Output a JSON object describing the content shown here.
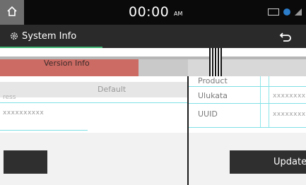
{
  "status_bar": {
    "clock": "00:00",
    "ampm": "AM",
    "icons": [
      "media-icon",
      "bluetooth-icon",
      "signal-icon"
    ]
  },
  "title_bar": {
    "title": "System Info"
  },
  "tab": {
    "label": "Version Info"
  },
  "left_panel": {
    "default_label": "Default",
    "row_cut_text": "ress",
    "value_text": "xxxxxxxxxx"
  },
  "right_panel": {
    "rows": [
      {
        "label": "Product",
        "value": ""
      },
      {
        "label": "Ulukata",
        "value": "xxxxxxxxx"
      },
      {
        "label": "UUID",
        "value": "xxxxxxxxxx"
      }
    ]
  },
  "buttons": {
    "update_label": "Update"
  },
  "colors": {
    "accent_green": "#3cb371",
    "tab_red": "#cc6b63",
    "cyan_line": "#7fe0e6"
  }
}
